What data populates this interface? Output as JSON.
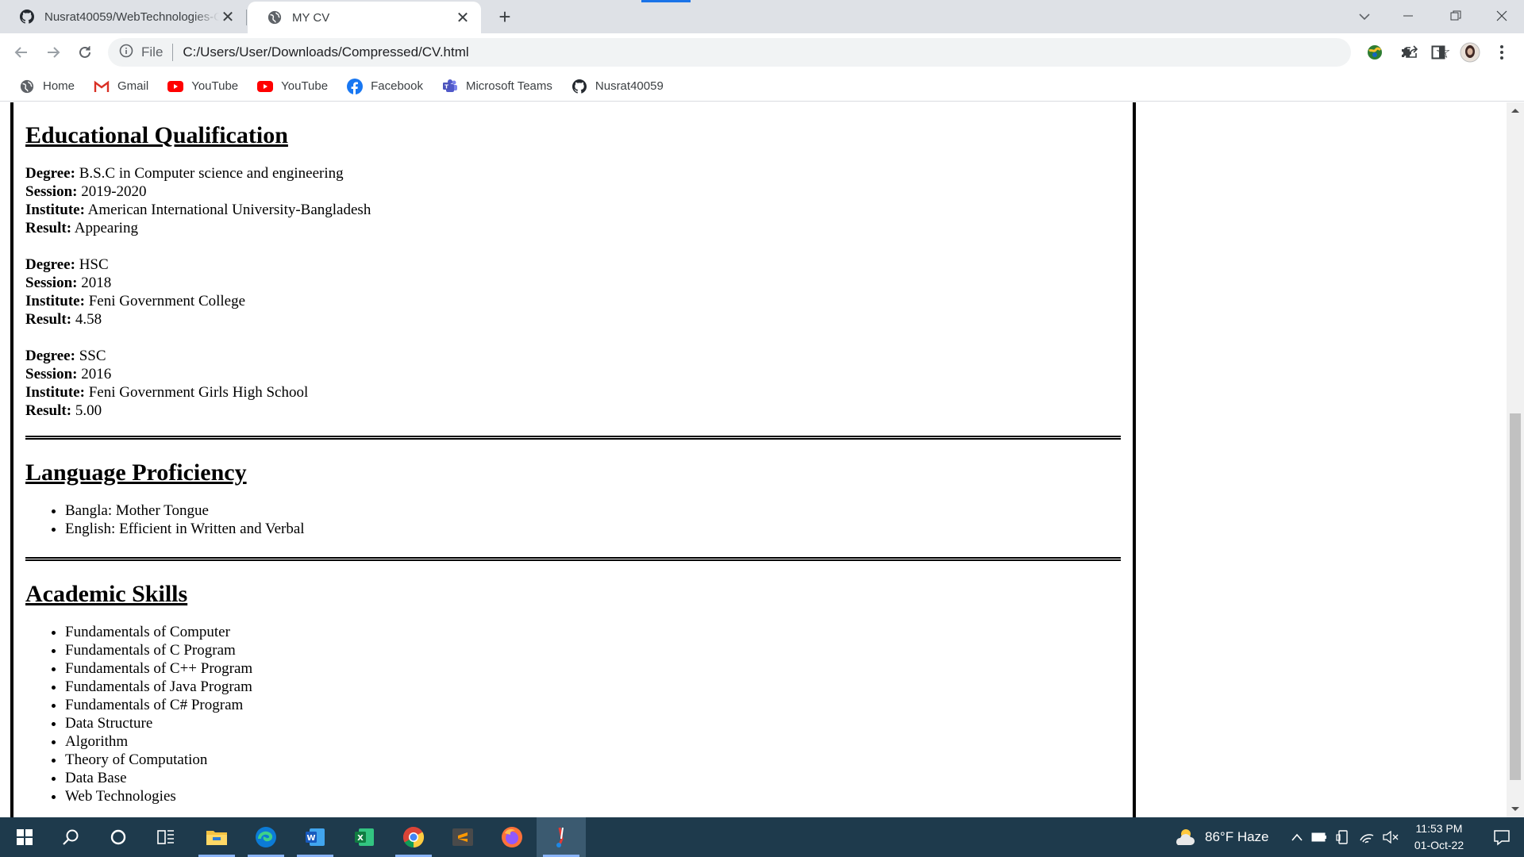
{
  "browser": {
    "tabs": [
      {
        "title": "Nusrat40059/WebTechnologies-C",
        "icon": "github-icon"
      },
      {
        "title": "MY CV",
        "icon": "globe-icon",
        "active": true
      }
    ],
    "address": {
      "scheme_label": "File",
      "url": "C:/Users/User/Downloads/Compressed/CV.html"
    },
    "bookmarks": [
      {
        "label": "Home",
        "icon": "globe-icon"
      },
      {
        "label": "Gmail",
        "icon": "gmail-icon"
      },
      {
        "label": "YouTube",
        "icon": "youtube-icon"
      },
      {
        "label": "YouTube",
        "icon": "youtube-icon"
      },
      {
        "label": "Facebook",
        "icon": "facebook-icon"
      },
      {
        "label": "Microsoft Teams",
        "icon": "teams-icon"
      },
      {
        "label": "Nusrat40059",
        "icon": "github-icon"
      }
    ]
  },
  "cv": {
    "education": {
      "title": "Educational Qualification",
      "records": [
        {
          "degree_label": "Degree:",
          "degree": "B.S.C in Computer science and engineering",
          "session_label": "Session:",
          "session": "2019-2020",
          "institute_label": "Institute:",
          "institute": "American International University-Bangladesh",
          "result_label": "Result:",
          "result": "Appearing"
        },
        {
          "degree_label": "Degree:",
          "degree": "HSC",
          "session_label": "Session:",
          "session": "2018",
          "institute_label": "Institute:",
          "institute": "Feni Government College",
          "result_label": "Result:",
          "result": "4.58"
        },
        {
          "degree_label": "Degree:",
          "degree": "SSC",
          "session_label": "Session:",
          "session": "2016",
          "institute_label": "Institute:",
          "institute": "Feni Government Girls High School",
          "result_label": "Result:",
          "result": "5.00"
        }
      ]
    },
    "language": {
      "title": "Language Proficiency",
      "items": [
        "Bangla: Mother Tongue",
        "English: Efficient in Written and Verbal"
      ]
    },
    "skills": {
      "title": "Academic Skills",
      "items": [
        "Fundamentals of Computer",
        "Fundamentals of C Program",
        "Fundamentals of C++ Program",
        "Fundamentals of Java Program",
        "Fundamentals of C# Program",
        "Data Structure",
        "Algorithm",
        "Theory of Computation",
        "Data Base",
        "Web Technologies"
      ]
    }
  },
  "taskbar": {
    "apps": [
      "start-icon",
      "search-icon",
      "cortana-icon",
      "task-view-icon",
      "file-explorer-icon",
      "edge-icon",
      "word-icon",
      "excel-icon",
      "chrome-icon",
      "sublime-icon",
      "firefox-icon",
      "snipping-tool-icon"
    ],
    "weather": "86°F  Haze",
    "time": "11:53 PM",
    "date": "01-Oct-22"
  },
  "colors": {
    "taskbar": "#1e3a4c",
    "tabstrip": "#dee1e6",
    "accent": "#1a73e8"
  }
}
